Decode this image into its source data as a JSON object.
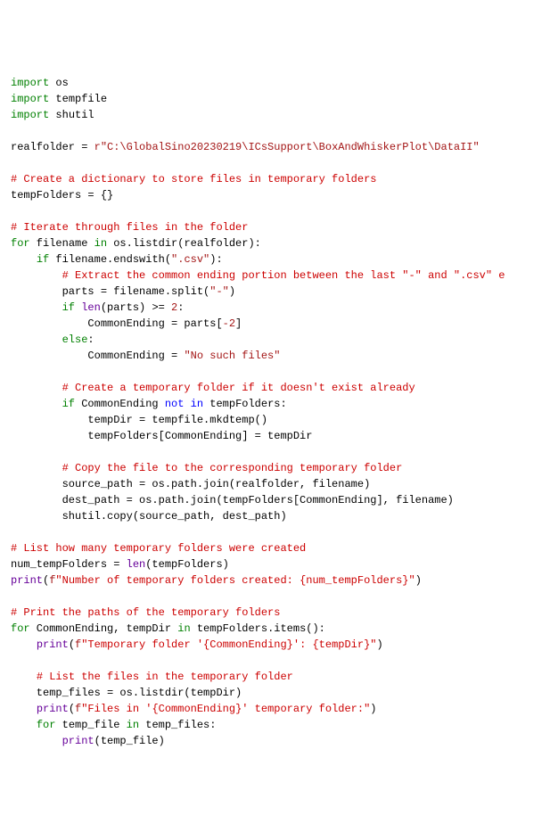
{
  "lines": [
    [
      [
        "kw",
        "import"
      ],
      [
        "ident",
        " os"
      ]
    ],
    [
      [
        "kw",
        "import"
      ],
      [
        "ident",
        " tempfile"
      ]
    ],
    [
      [
        "kw",
        "import"
      ],
      [
        "ident",
        " shutil"
      ]
    ],
    [],
    [
      [
        "ident",
        "realfolder = "
      ],
      [
        "rprefix",
        "r"
      ],
      [
        "str",
        "\"C:\\GlobalSino20230219\\ICsSupport\\BoxAndWhiskerPlot\\DataII\""
      ]
    ],
    [],
    [
      [
        "cmt",
        "# Create a dictionary to store files in temporary folders"
      ]
    ],
    [
      [
        "ident",
        "tempFolders = {}"
      ]
    ],
    [],
    [
      [
        "cmt",
        "# Iterate through files in the folder"
      ]
    ],
    [
      [
        "kw",
        "for"
      ],
      [
        "ident",
        " filename "
      ],
      [
        "kw",
        "in"
      ],
      [
        "ident",
        " os.listdir(realfolder):"
      ]
    ],
    [
      [
        "ident",
        "    "
      ],
      [
        "kw",
        "if"
      ],
      [
        "ident",
        " filename.endswith("
      ],
      [
        "str",
        "\".csv\""
      ],
      [
        "ident",
        "):"
      ]
    ],
    [
      [
        "ident",
        "        "
      ],
      [
        "cmt",
        "# Extract the common ending portion between the last \"-\" and \".csv\" e"
      ]
    ],
    [
      [
        "ident",
        "        parts = filename.split("
      ],
      [
        "str",
        "\"-\""
      ],
      [
        "ident",
        ")"
      ]
    ],
    [
      [
        "ident",
        "        "
      ],
      [
        "kw",
        "if"
      ],
      [
        "ident",
        " "
      ],
      [
        "builtin",
        "len"
      ],
      [
        "ident",
        "(parts) >= "
      ],
      [
        "str",
        "2"
      ],
      [
        "ident",
        ":"
      ]
    ],
    [
      [
        "ident",
        "            CommonEnding = parts["
      ],
      [
        "str",
        "-2"
      ],
      [
        "ident",
        "]"
      ]
    ],
    [
      [
        "ident",
        "        "
      ],
      [
        "kw",
        "else"
      ],
      [
        "ident",
        ":"
      ]
    ],
    [
      [
        "ident",
        "            CommonEnding = "
      ],
      [
        "str",
        "\"No such files\""
      ]
    ],
    [],
    [
      [
        "ident",
        "        "
      ],
      [
        "cmt",
        "# Create a temporary folder if it doesn't exist already"
      ]
    ],
    [
      [
        "ident",
        "        "
      ],
      [
        "kw",
        "if"
      ],
      [
        "ident",
        " CommonEnding "
      ],
      [
        "not",
        "not in"
      ],
      [
        "ident",
        " tempFolders:"
      ]
    ],
    [
      [
        "ident",
        "            tempDir = tempfile.mkdtemp()"
      ]
    ],
    [
      [
        "ident",
        "            tempFolders[CommonEnding] = tempDir"
      ]
    ],
    [],
    [
      [
        "ident",
        "        "
      ],
      [
        "cmt",
        "# Copy the file to the corresponding temporary folder"
      ]
    ],
    [
      [
        "ident",
        "        source_path = os.path.join(realfolder, filename)"
      ]
    ],
    [
      [
        "ident",
        "        dest_path = os.path.join(tempFolders[CommonEnding], filename)"
      ]
    ],
    [
      [
        "ident",
        "        shutil.copy(source_path, dest_path)"
      ]
    ],
    [],
    [
      [
        "cmt",
        "# List how many temporary folders were created"
      ]
    ],
    [
      [
        "ident",
        "num_tempFolders = "
      ],
      [
        "builtin",
        "len"
      ],
      [
        "ident",
        "(tempFolders)"
      ]
    ],
    [
      [
        "builtin",
        "print"
      ],
      [
        "ident",
        "("
      ],
      [
        "rprefix",
        "f"
      ],
      [
        "fstr",
        "\"Number of temporary folders created: {num_tempFolders}\""
      ],
      [
        "ident",
        ")"
      ]
    ],
    [],
    [
      [
        "cmt",
        "# Print the paths of the temporary folders"
      ]
    ],
    [
      [
        "kw",
        "for"
      ],
      [
        "ident",
        " CommonEnding, tempDir "
      ],
      [
        "kw",
        "in"
      ],
      [
        "ident",
        " tempFolders.items():"
      ]
    ],
    [
      [
        "ident",
        "    "
      ],
      [
        "builtin",
        "print"
      ],
      [
        "ident",
        "("
      ],
      [
        "rprefix",
        "f"
      ],
      [
        "fstr",
        "\"Temporary folder '{CommonEnding}': {tempDir}\""
      ],
      [
        "ident",
        ")"
      ]
    ],
    [],
    [
      [
        "ident",
        "    "
      ],
      [
        "cmt",
        "# List the files in the temporary folder"
      ]
    ],
    [
      [
        "ident",
        "    temp_files = os.listdir(tempDir)"
      ]
    ],
    [
      [
        "ident",
        "    "
      ],
      [
        "builtin",
        "print"
      ],
      [
        "ident",
        "("
      ],
      [
        "rprefix",
        "f"
      ],
      [
        "fstr",
        "\"Files in '{CommonEnding}' temporary folder:\""
      ],
      [
        "ident",
        ")"
      ]
    ],
    [
      [
        "ident",
        "    "
      ],
      [
        "kw",
        "for"
      ],
      [
        "ident",
        " temp_file "
      ],
      [
        "kw",
        "in"
      ],
      [
        "ident",
        " temp_files:"
      ]
    ],
    [
      [
        "ident",
        "        "
      ],
      [
        "builtin",
        "print"
      ],
      [
        "ident",
        "(temp_file)"
      ]
    ]
  ]
}
